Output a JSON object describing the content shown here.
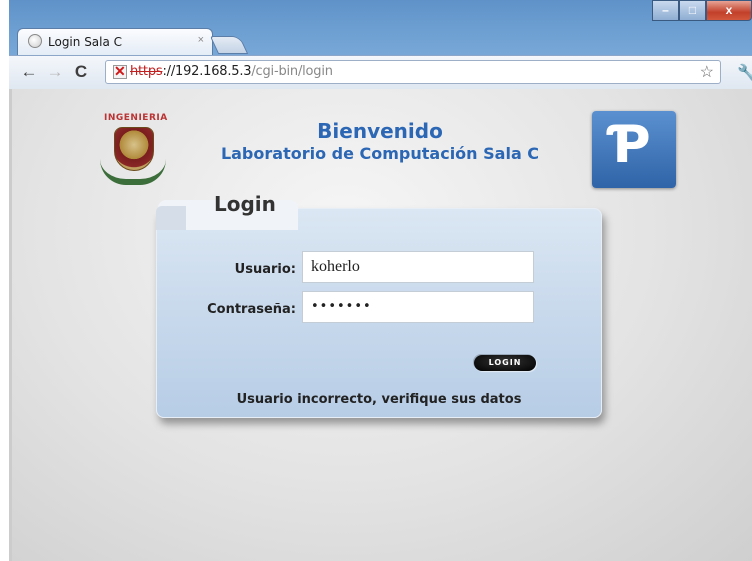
{
  "browser": {
    "tab_title": "Login Sala C",
    "tab_close": "×",
    "url_scheme": "https",
    "url_host": "://192.168.5.3",
    "url_path": "/cgi-bin/login",
    "window_controls": [
      "–",
      "□",
      "x"
    ]
  },
  "page": {
    "welcome_line1": "Bienvenido",
    "welcome_line2": "Laboratorio de Computación Sala C",
    "logo_left_text": "INGENIERIA",
    "login_title": "Login",
    "usuario_label": "Usuario:",
    "usuario_value": "koherlo",
    "password_label": "Contraseña:",
    "password_value": "•••••••",
    "login_button": "LOGIN",
    "error_message": "Usuario incorrecto, verifique sus datos"
  }
}
